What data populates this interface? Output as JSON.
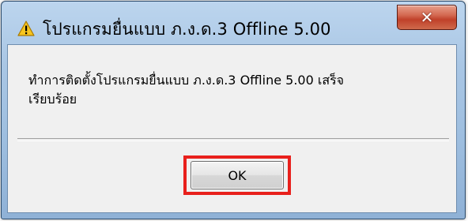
{
  "dialog": {
    "title": "โปรแกรมยื่นแบบ ภ.ง.ด.3  Offline 5.00",
    "close_icon": "close-icon",
    "warning_icon": "warning-icon",
    "message_line1": "ทำการติดตั้งโปรแกรมยื่นแบบ ภ.ง.ด.3 Offline 5.00 เสร็จ",
    "message_line2": "เรียบร้อย",
    "ok_label": "OK",
    "colors": {
      "highlight": "#e8201c",
      "client_bg": "#f0f0f0",
      "frame": "#a9c6e4",
      "close_button": "#c0412a"
    }
  }
}
